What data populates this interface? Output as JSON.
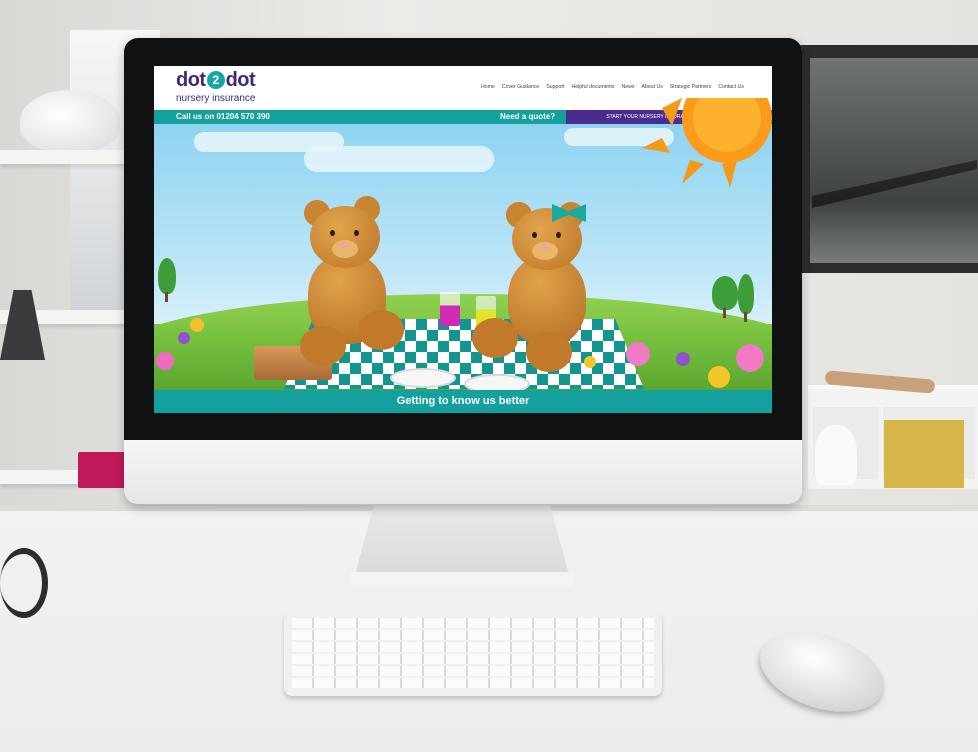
{
  "site": {
    "logo_left": "dot",
    "logo_mid": "2",
    "logo_right": "dot",
    "logo_sub": "nursery insurance",
    "nav": [
      "Home",
      "Cover Guidance",
      "Support",
      "Helpful documents",
      "News",
      "About Us",
      "Strategic Partners",
      "Contact Us"
    ],
    "phone": "Call us on 01204 570 390",
    "need_quote": "Need a quote?",
    "quote_button": "START YOUR NURSERY INSURANCE QUOTE TODAY",
    "hero_caption": "Getting to know us better",
    "colors": {
      "brand_purple": "#3d2a7d",
      "teal": "#14a09c",
      "button_purple": "#4b2c8e"
    }
  }
}
